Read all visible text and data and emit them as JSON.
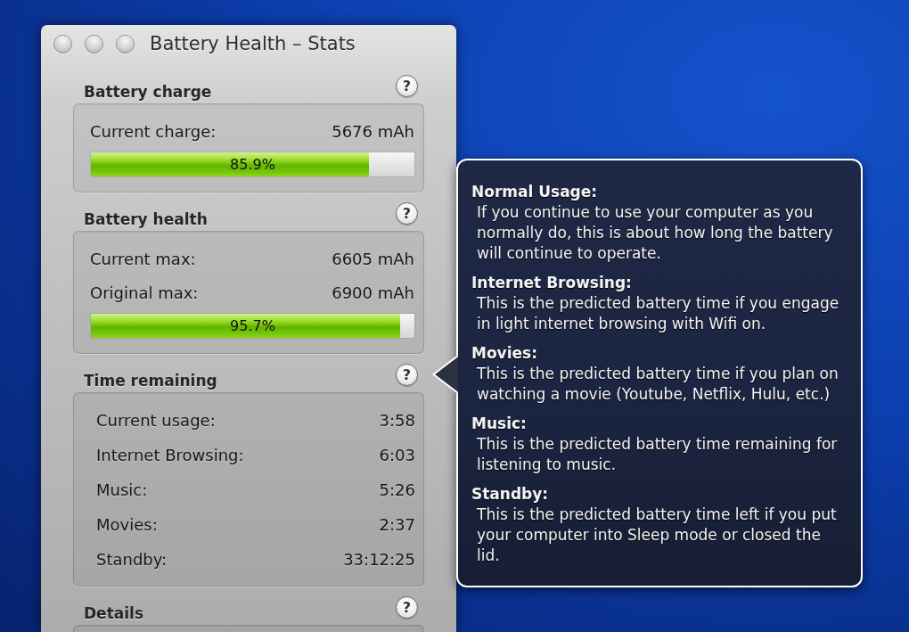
{
  "window": {
    "title": "Battery Health – Stats"
  },
  "sections": [
    {
      "kind": "meter",
      "heading": "Battery charge",
      "help": "?",
      "rows": [
        {
          "label": "Current charge:",
          "value": "5676 mAh"
        }
      ],
      "bar": {
        "level": 0.859,
        "reading": "85.9%"
      }
    },
    {
      "kind": "meter",
      "heading": "Battery health",
      "help": "?",
      "rows": [
        {
          "label": "Current max:",
          "value": "6605 mAh"
        },
        {
          "label": "Original max:",
          "value": "6900 mAh"
        }
      ],
      "bar": {
        "level": 0.957,
        "reading": "95.7%"
      }
    },
    {
      "kind": "list",
      "heading": "Time remaining",
      "help": "?",
      "rows": [
        {
          "label": "Current usage:",
          "value": "3:58"
        },
        {
          "label": "Internet Browsing:",
          "value": "6:03"
        },
        {
          "label": "Music:",
          "value": "5:26"
        },
        {
          "label": "Movies:",
          "value": "2:37"
        },
        {
          "label": "Standby:",
          "value": "33:12:25"
        }
      ]
    },
    {
      "kind": "list",
      "heading": "Details",
      "help": "?"
    }
  ],
  "help_popover": {
    "entries": [
      {
        "title": "Normal Usage:",
        "text": "If you continue to use your computer as you normally do, this is about how long the battery will continue to operate."
      },
      {
        "title": "Internet Browsing:",
        "text": "This is the predicted battery time if you engage in light internet browsing with Wifi on."
      },
      {
        "title": "Movies:",
        "text": "This is the predicted battery time if you plan on watching a movie (Youtube, Netflix, Hulu, etc.)"
      },
      {
        "title": "Music:",
        "text": "This is the predicted battery time remaining for listening to music."
      },
      {
        "title": "Standby:",
        "text": "This is the predicted battery time left if you put your computer into Sleep mode or closed the lid."
      }
    ]
  }
}
